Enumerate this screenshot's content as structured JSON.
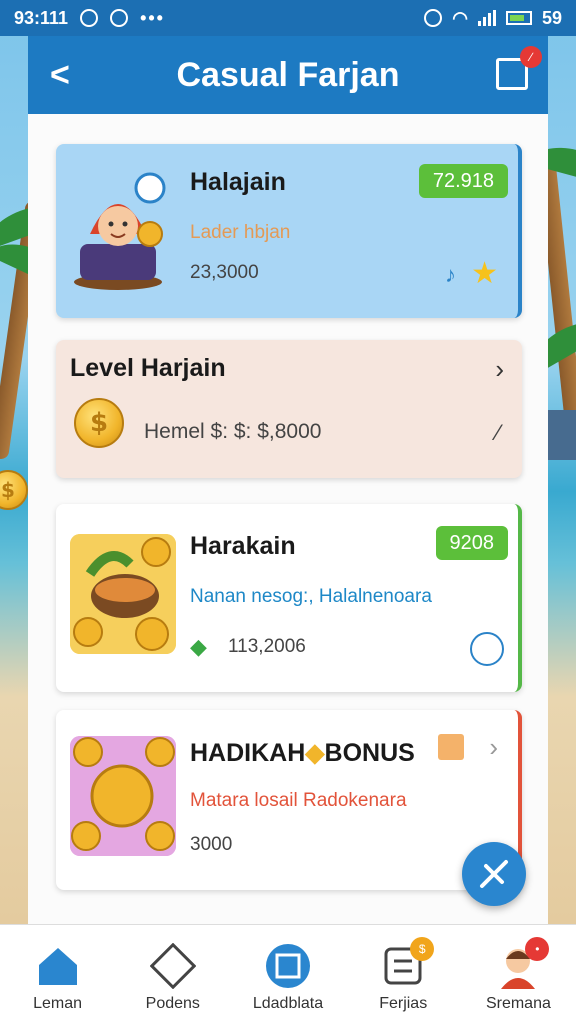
{
  "status_bar": {
    "time": "93:111",
    "battery_text": "59"
  },
  "header": {
    "back_icon": "back-arrow-icon",
    "title": "Casual Farjan",
    "cart_icon": "cart-icon",
    "cart_badge": "∕"
  },
  "cards": [
    {
      "title": "Halajain",
      "subtitle": "Lader hbjan",
      "value": "23,3000",
      "badge": "72.918",
      "subtitle_color": "#e49a55"
    },
    {
      "title": "Level Harjain",
      "value": "Hemel $: $: $,8000"
    },
    {
      "title": "Harakain",
      "subtitle": "Nanan nesog:, Halalnenoara",
      "value": "113,2006",
      "badge": "9208",
      "subtitle_color": "#1e88c7"
    },
    {
      "title": "HADIKAH",
      "title_suffix": "BONUS",
      "subtitle": "Matara losail Radokenara",
      "value": "3000",
      "subtitle_color": "#e2533a"
    }
  ],
  "bottom_nav": [
    {
      "label": "Leman",
      "icon": "home-icon"
    },
    {
      "label": "Podens",
      "icon": "map-icon"
    },
    {
      "label": "Ldadblata",
      "icon": "leaderboard-icon"
    },
    {
      "label": "Ferjias",
      "icon": "tasks-icon"
    },
    {
      "label": "Sremana",
      "icon": "profile-avatar-icon"
    }
  ],
  "colors": {
    "primary": "#1d7ac2",
    "green": "#5cbf3a",
    "red": "#e2533a"
  }
}
